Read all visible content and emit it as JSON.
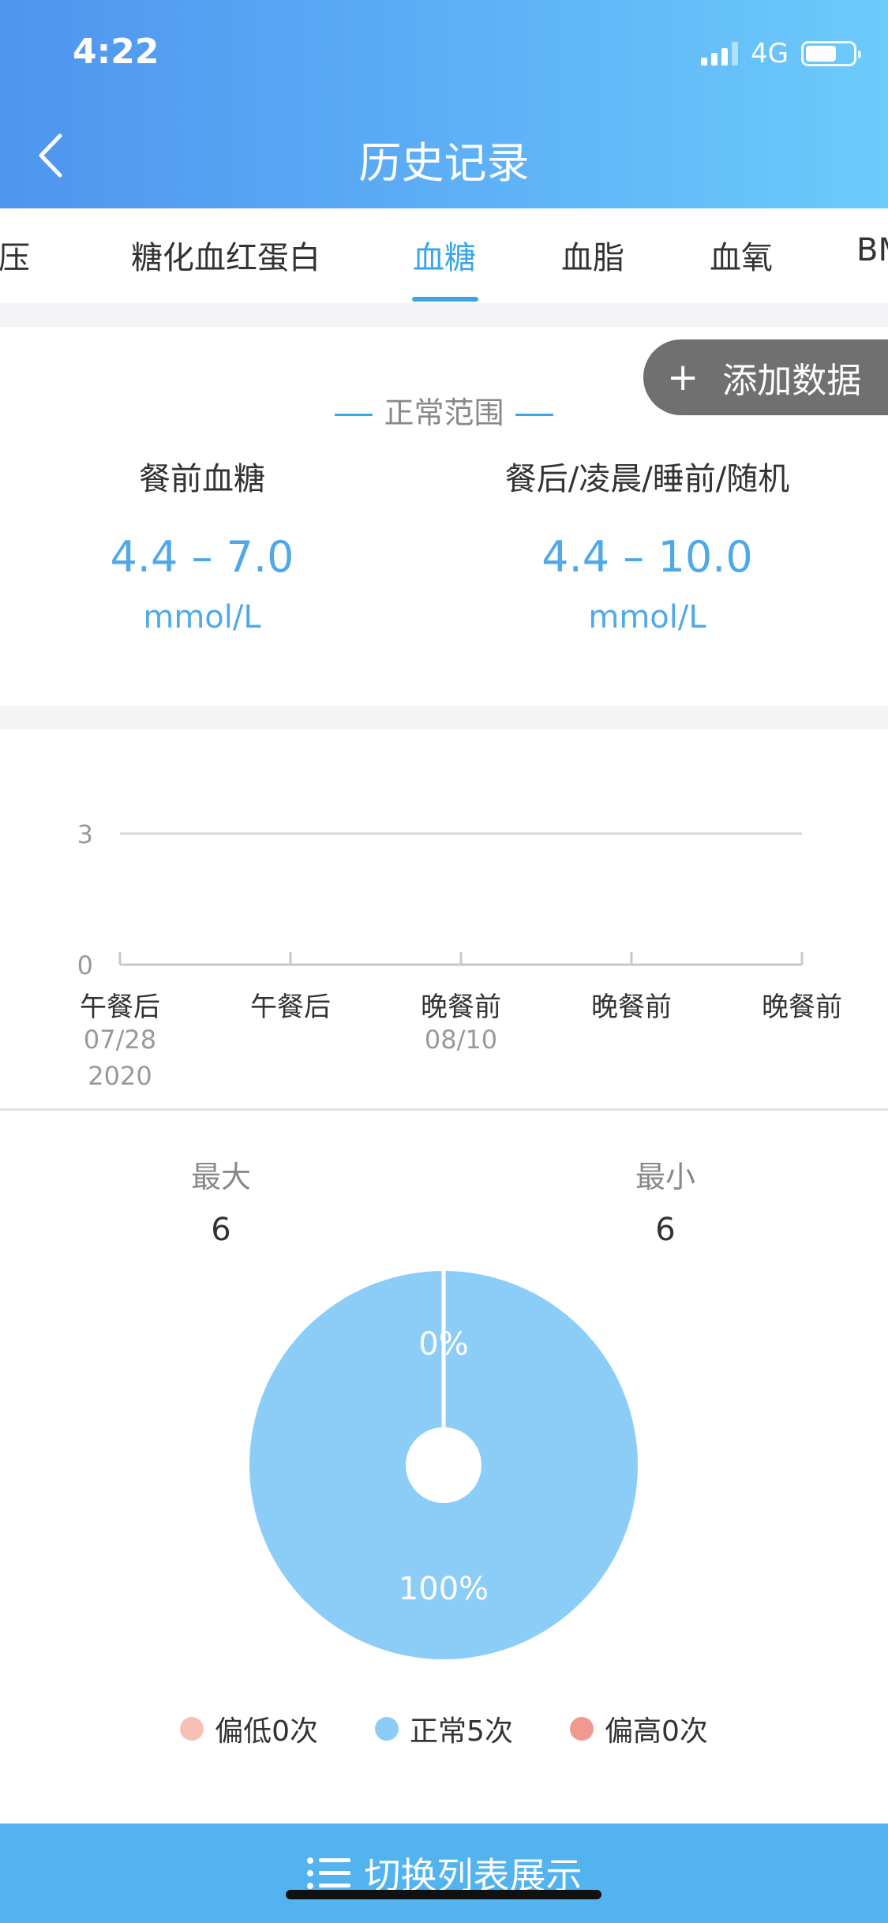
{
  "status": {
    "time": "4:22",
    "network": "4G"
  },
  "header": {
    "title": "历史记录"
  },
  "tabs": [
    {
      "label": "血压"
    },
    {
      "label": "糖化血红蛋白"
    },
    {
      "label": "血糖"
    },
    {
      "label": "血脂"
    },
    {
      "label": "血氧"
    },
    {
      "label": "BMI"
    }
  ],
  "active_tab": "血糖",
  "range": {
    "add_label": "添加数据",
    "title": "正常范围",
    "before_meal": {
      "label": "餐前血糖",
      "value": "4.4 – 7.0",
      "unit": "mmol/L"
    },
    "after_meal": {
      "label": "餐后/凌晨/睡前/随机",
      "value": "4.4 – 10.0",
      "unit": "mmol/L"
    }
  },
  "chart_data": {
    "type": "line",
    "categories": [
      "午餐后",
      "午餐后",
      "晚餐前",
      "晚餐前",
      "晚餐前"
    ],
    "dates": [
      "07/28",
      "",
      "08/10",
      "",
      ""
    ],
    "year": "2020",
    "y_ticks": [
      "0",
      "3"
    ],
    "ylim": [
      0,
      3
    ],
    "series": [],
    "grid": true
  },
  "stats": {
    "max_label": "最大",
    "max_value": "6",
    "min_label": "最小",
    "min_value": "6"
  },
  "pie": {
    "slices": [
      {
        "label": "0%",
        "value": 0,
        "color": "#ffffff"
      },
      {
        "label": "100%",
        "value": 100,
        "color": "#8ccdf8"
      }
    ]
  },
  "legend": [
    {
      "label": "偏低0次",
      "color": "#f7c0b5"
    },
    {
      "label": "正常5次",
      "color": "#8ccdf8"
    },
    {
      "label": "偏高0次",
      "color": "#ef9a8c"
    }
  ],
  "bottom": {
    "label": "切换列表展示"
  },
  "colors": {
    "accent": "#3aa6e8",
    "header_start": "#4f95ef",
    "header_end": "#6ccbfb",
    "bottom_bar": "#52b3ef"
  }
}
